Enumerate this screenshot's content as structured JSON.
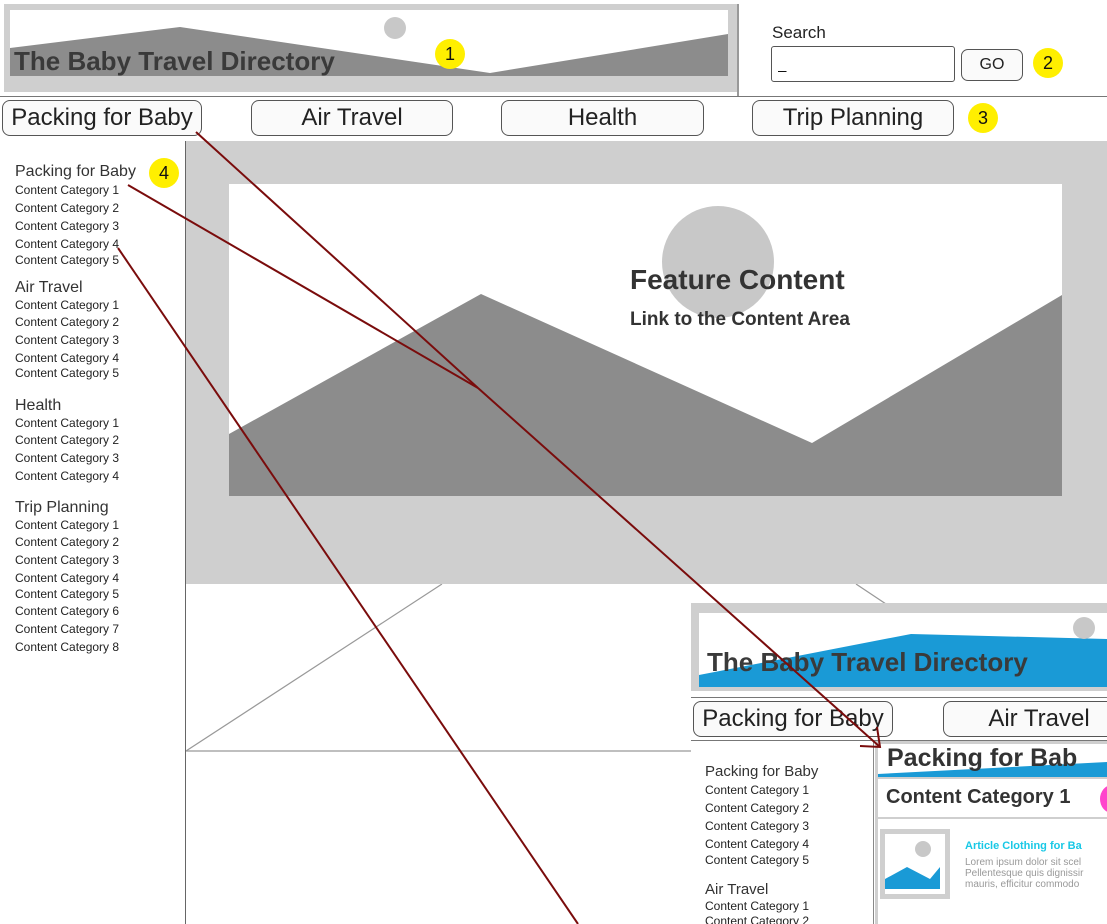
{
  "header": {
    "site_title": "The Baby Travel Directory",
    "marker": "1"
  },
  "search": {
    "label": "Search",
    "value": "_",
    "go_label": "GO",
    "marker": "2"
  },
  "nav": {
    "items": [
      {
        "label": "Packing for Baby"
      },
      {
        "label": "Air Travel"
      },
      {
        "label": "Health"
      },
      {
        "label": "Trip Planning"
      }
    ],
    "marker": "3"
  },
  "sidebar": {
    "marker": "4",
    "sections": [
      {
        "title": "Packing for Baby",
        "items": [
          "Content Category 1",
          "Content Category 2",
          "Content Category 3",
          "Content Category 4",
          "Content Category 5"
        ]
      },
      {
        "title": "Air Travel",
        "items": [
          "Content Category 1",
          "Content Category 2",
          "Content Category 3",
          "Content Category 4",
          "Content Category 5"
        ]
      },
      {
        "title": "Health",
        "items": [
          "Content Category 1",
          "Content Category 2",
          "Content Category 3",
          "Content Category 4"
        ]
      },
      {
        "title": "Trip Planning",
        "items": [
          "Content Category 1",
          "Content Category 2",
          "Content Category 3",
          "Content Category 4",
          "Content Category 5",
          "Content Category 6",
          "Content Category 7",
          "Content Category 8"
        ]
      }
    ]
  },
  "feature": {
    "title": "Feature Content",
    "link": "Link to the Content Area"
  },
  "inset": {
    "site_title": "The Baby Travel Directory",
    "nav_items": [
      "Packing for Baby",
      "Air Travel"
    ],
    "sidebar_title": "Packing for Baby",
    "sidebar_items": [
      "Content Category 1",
      "Content Category 2",
      "Content Category 3",
      "Content Category 4",
      "Content Category 5"
    ],
    "sidebar_title_2": "Air Travel",
    "sidebar_items_2": [
      "Content Category 1",
      "Content Category 2"
    ],
    "page_heading": "Packing for Bab",
    "category_heading": "Content Category 1",
    "article_title": "Article Clothing for Ba",
    "lorem": [
      "Lorem ipsum dolor sit scel",
      "Pellentesque quis dignissir",
      "mauris, efficitur commodo"
    ]
  },
  "colors": {
    "accent_blue": "#1a9ad6",
    "link_cyan": "#19c8e6",
    "marker_yellow": "#ffef00",
    "marker_pink": "#ff44cc",
    "arrow": "#7a0c0c",
    "placeholder_gray": "#cfcfcf"
  }
}
